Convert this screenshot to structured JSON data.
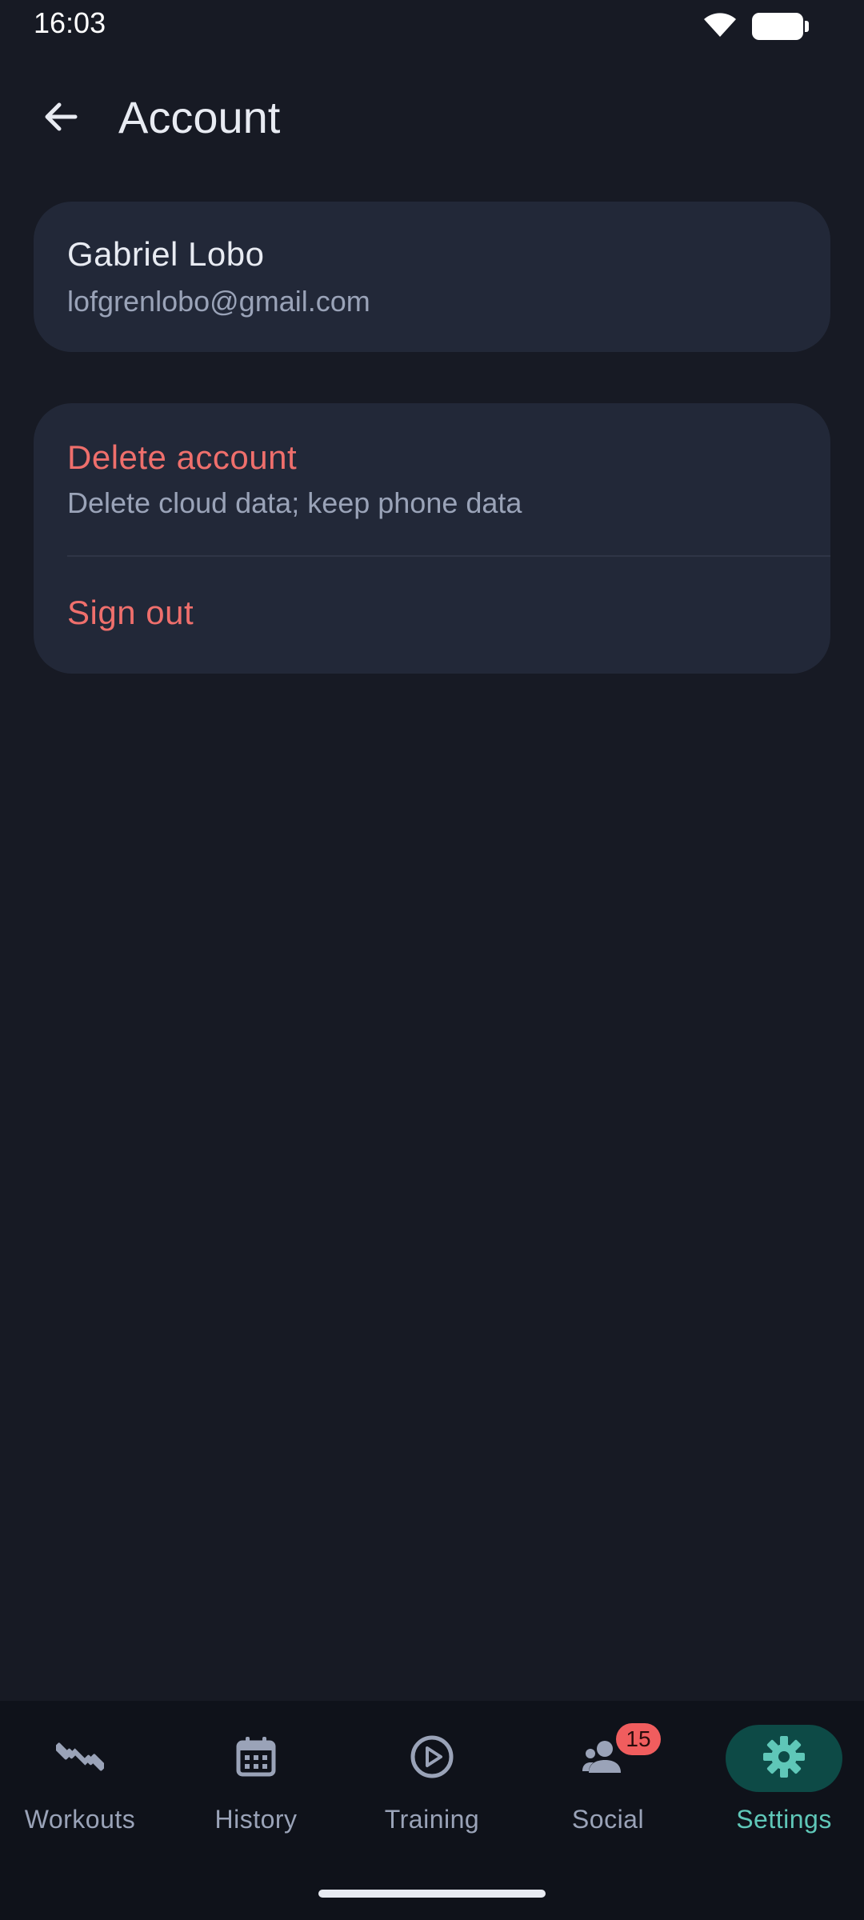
{
  "status_bar": {
    "time": "16:03",
    "icons": [
      "wifi-icon",
      "battery-icon"
    ]
  },
  "app_bar": {
    "back_icon": "arrow-back-icon",
    "title": "Account"
  },
  "profile": {
    "name": "Gabriel Lobo",
    "email": "lofgrenlobo@gmail.com"
  },
  "actions": {
    "delete_title": "Delete account",
    "delete_subtitle": "Delete cloud data; keep phone data",
    "signout_label": "Sign out"
  },
  "bottom_nav": {
    "items": [
      {
        "label": "Workouts",
        "icon": "dumbbell-icon",
        "active": false
      },
      {
        "label": "History",
        "icon": "calendar-icon",
        "active": false
      },
      {
        "label": "Training",
        "icon": "play-circle-icon",
        "active": false
      },
      {
        "label": "Social",
        "icon": "people-icon",
        "active": false,
        "badge": "15"
      },
      {
        "label": "Settings",
        "icon": "gear-icon",
        "active": true
      }
    ]
  },
  "colors": {
    "background": "#171a24",
    "card": "#222838",
    "danger": "#ef6f6c",
    "accent": "#5fc7b8",
    "accent_container": "#0d4a46",
    "badge": "#f05d5e"
  }
}
